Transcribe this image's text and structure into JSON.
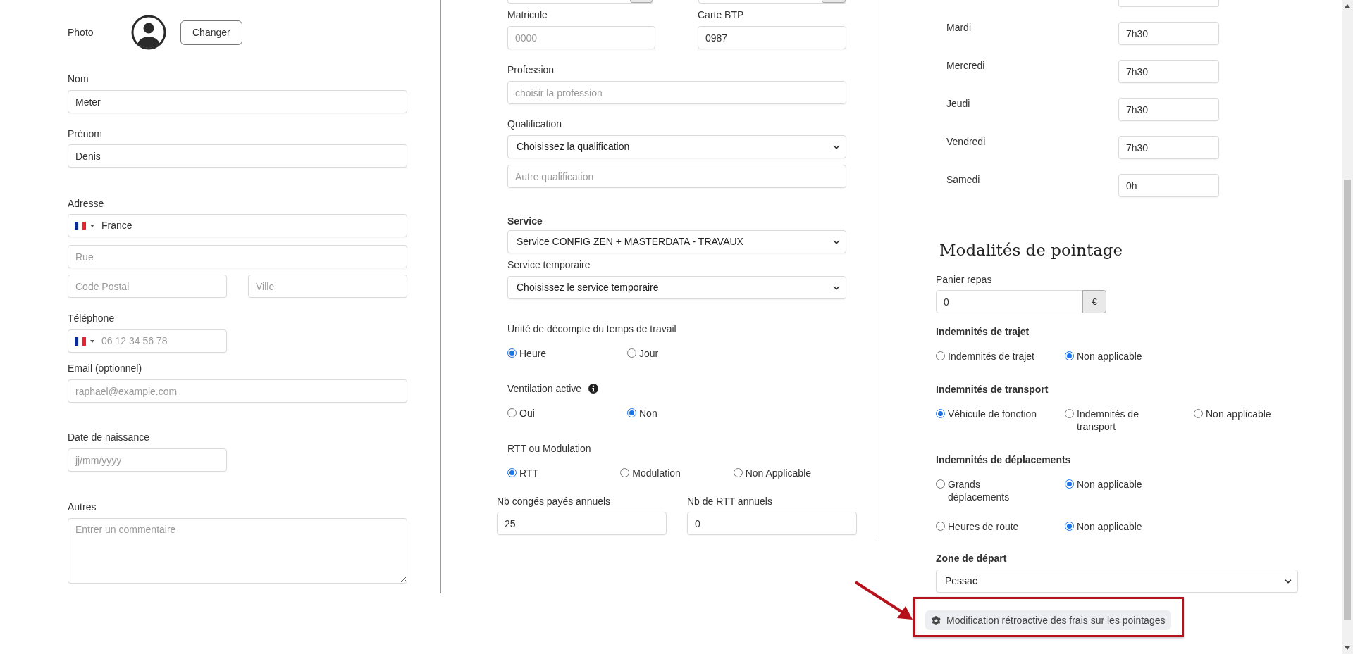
{
  "identity": {
    "photo": {
      "label": "Photo",
      "button": "Changer"
    },
    "last_name": {
      "label": "Nom",
      "value": "Meter"
    },
    "first_name": {
      "label": "Prénom",
      "value": "Denis"
    },
    "address": {
      "label": "Adresse",
      "country": "France",
      "street_placeholder": "Rue",
      "postal_code_placeholder": "Code Postal",
      "city_placeholder": "Ville"
    },
    "phone": {
      "label": "Téléphone",
      "placeholder": "06 12 34 56 78"
    },
    "email": {
      "label": "Email (optionnel)",
      "placeholder": "raphael@example.com"
    },
    "birth_date": {
      "label": "Date de naissance",
      "placeholder": "jj/mm/yyyy"
    },
    "comments": {
      "label": "Autres",
      "placeholder": "Entrer un commentaire"
    }
  },
  "employment": {
    "matricule": {
      "label": "Matricule",
      "placeholder": "0000"
    },
    "btp_card": {
      "label": "Carte BTP",
      "value": "0987"
    },
    "profession": {
      "label": "Profession",
      "placeholder": "choisir la profession"
    },
    "qualification": {
      "label": "Qualification",
      "value": "Choisissez la qualification",
      "other_placeholder": "Autre qualification"
    },
    "service": {
      "label": "Service",
      "value": "Service CONFIG ZEN + MASTERDATA - TRAVAUX"
    },
    "temporary_service": {
      "label": "Service temporaire",
      "value": "Choisissez le service temporaire"
    },
    "radio_groups": [
      {
        "label": "Unité de décompte du temps de travail",
        "info": false,
        "options": [
          {
            "label": "Heure",
            "selected": true
          },
          {
            "label": "Jour",
            "selected": false
          }
        ]
      },
      {
        "label": "Ventilation active",
        "info": true,
        "options": [
          {
            "label": "Oui",
            "selected": false
          },
          {
            "label": "Non",
            "selected": true
          }
        ]
      },
      {
        "label": "RTT ou Modulation",
        "info": false,
        "options": [
          {
            "label": "RTT",
            "selected": true
          },
          {
            "label": "Modulation",
            "selected": false
          },
          {
            "label": "Non Applicable",
            "selected": false
          }
        ]
      }
    ],
    "paid_leave": {
      "label": "Nb congés payés annuels",
      "value": "25"
    },
    "rtt_days": {
      "label": "Nb de RTT annuels",
      "value": "0"
    }
  },
  "schedule": [
    {
      "day": "Mardi",
      "value": "7h30"
    },
    {
      "day": "Mercredi",
      "value": "7h30"
    },
    {
      "day": "Jeudi",
      "value": "7h30"
    },
    {
      "day": "Vendredi",
      "value": "7h30"
    },
    {
      "day": "Samedi",
      "value": "0h"
    }
  ],
  "pointage": {
    "title": "Modalités de pointage",
    "meal": {
      "label": "Panier repas",
      "value": "0",
      "unit": "€"
    },
    "groups": [
      {
        "label": "Indemnités de trajet",
        "rows": [
          [
            {
              "label": "Indemnités de trajet",
              "selected": false
            },
            {
              "label": "Non applicable",
              "selected": true
            }
          ]
        ]
      },
      {
        "label": "Indemnités de transport",
        "rows": [
          [
            {
              "label": "Véhicule de fonction",
              "selected": true
            },
            {
              "label": "Indemnités de transport",
              "selected": false
            },
            {
              "label": "Non applicable",
              "selected": false
            }
          ]
        ]
      },
      {
        "label": "Indemnités de déplacements",
        "rows": [
          [
            {
              "label": "Grands déplacements",
              "selected": false
            },
            {
              "label": "Non applicable",
              "selected": true
            }
          ],
          [
            {
              "label": "Heures de route",
              "selected": false
            },
            {
              "label": "Non applicable",
              "selected": true
            }
          ]
        ]
      }
    ],
    "start_zone": {
      "label": "Zone de départ",
      "value": "Pessac"
    },
    "retro_button": "Modification rétroactive des frais sur les pointages"
  }
}
